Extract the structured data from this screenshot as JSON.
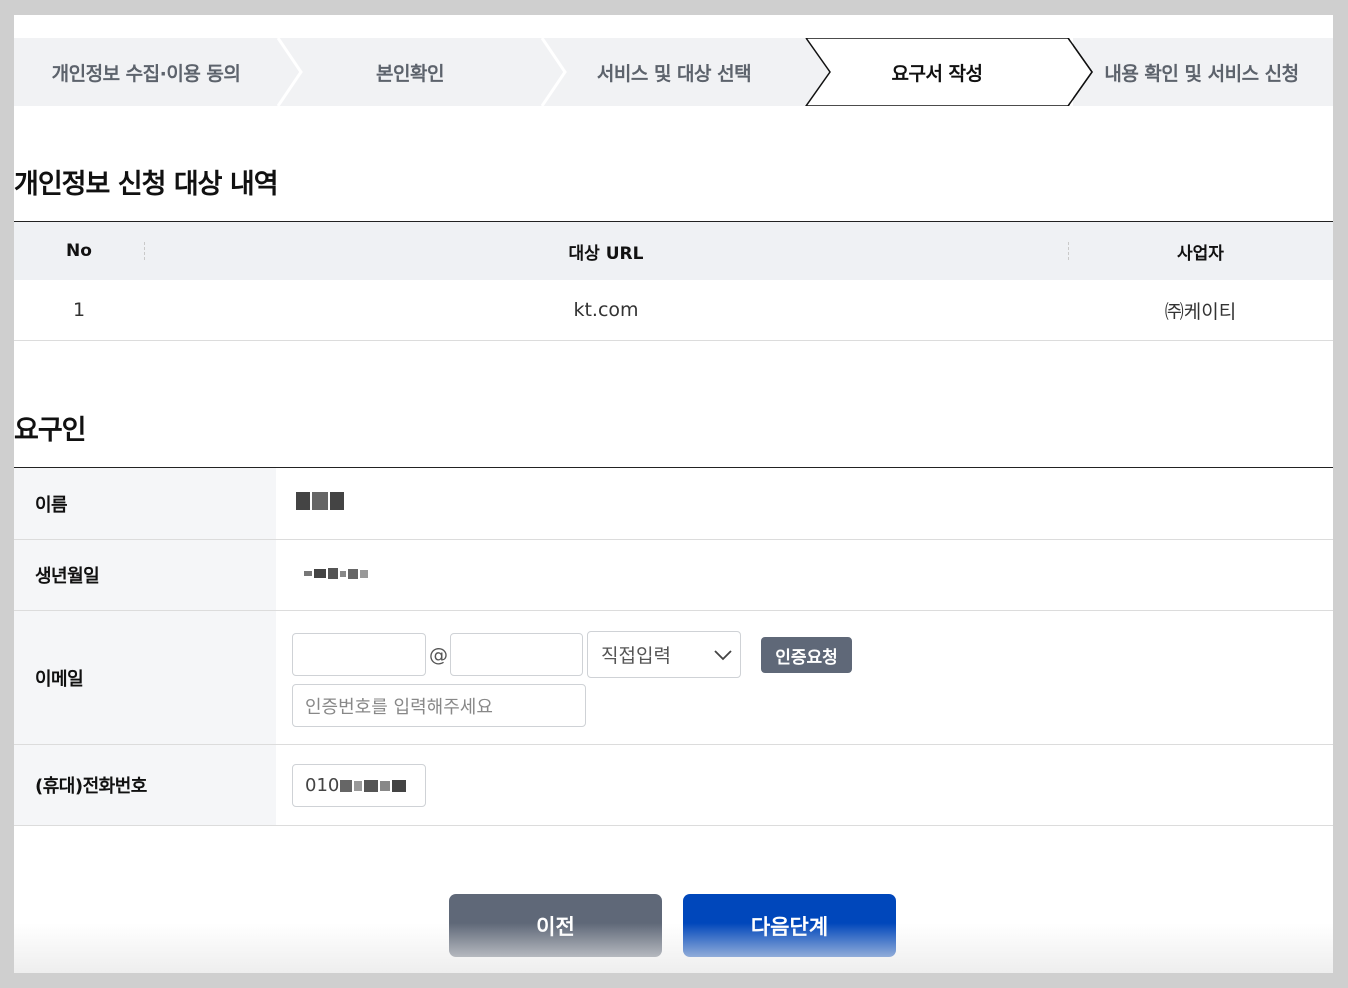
{
  "steps": [
    {
      "label": "개인정보 수집·이용 동의"
    },
    {
      "label": "본인확인"
    },
    {
      "label": "서비스 및 대상 선택"
    },
    {
      "label": "요구서 작성"
    },
    {
      "label": "내용 확인 및 서비스 신청"
    }
  ],
  "target_section": {
    "title": "개인정보 신청 대상 내역",
    "columns": [
      "No",
      "대상 URL",
      "사업자"
    ],
    "rows": [
      {
        "no": "1",
        "url": "kt.com",
        "company": "㈜케이티"
      }
    ]
  },
  "requester_section": {
    "title": "요구인",
    "name_label": "이름",
    "birth_label": "생년월일",
    "email_label": "이메일",
    "email_at": "@",
    "email_domain_select": "직접입력",
    "verify_button": "인증요청",
    "verify_code_placeholder": "인증번호를 입력해주세요",
    "phone_label": "(휴대)전화번호",
    "phone_prefix": "010"
  },
  "buttons": {
    "prev": "이전",
    "next": "다음단계"
  },
  "colors": {
    "primary": "#0047bb",
    "secondary": "#5f6878",
    "step_bg": "#f1f2f4"
  }
}
